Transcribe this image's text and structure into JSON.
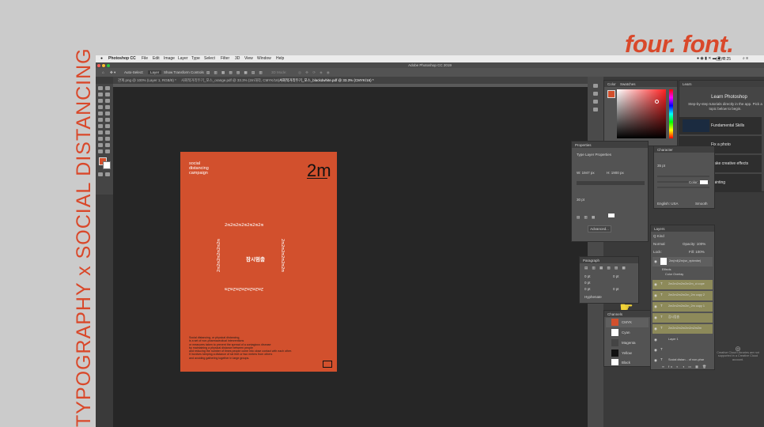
{
  "side_title": "TYPOGRAPHY x SOCIAL DISTANCING",
  "brand": {
    "text": "four. font.",
    "color": "#d9482a"
  },
  "mac_bar": {
    "app_name": "Photoshop CC",
    "menus": [
      "File",
      "Edit",
      "Image",
      "Layer",
      "Type",
      "Select",
      "Filter",
      "3D",
      "View",
      "Window",
      "Help"
    ],
    "clock": "(금) 2:25"
  },
  "ps": {
    "window_title": "Adobe Photoshop CC 2019",
    "options": {
      "auto_select": "Auto-Select:",
      "layer_select": "Layer",
      "transform": "Show Transform Controls",
      "mode_label": "3D Mode:"
    },
    "tabs": [
      "관계.png @ 100% (Layer 1, RGB/8) *",
      "사회적거리두기_포스_orange.pdf @ 33.3% (2m대각, CMYK/16) *",
      "사회적거리두기_포스_blackdwhite.pdf @ 33.3% (CMYK/16) *"
    ]
  },
  "poster": {
    "background": "#d2502d",
    "campaign_lines": [
      "social",
      "distancing",
      "campaign"
    ],
    "big_label": "2m",
    "ring_top": "2m2m2m2m2m2m2m",
    "ring_bottom": "2m2m2m2m2m2m2m",
    "ring_left": "2m2m2m2m2m2m",
    "ring_right": "2m2m2m2m2m2m",
    "center_text": "잠시멈춤",
    "body_lines": [
      "Social distancing, or physical distancing,",
      "is a set of non-pharmaceutical interventions",
      "or measures taken to prevent the spread of a contagious disease",
      "by maintaining a physical distance between people",
      "and reducing the number of times people come into close contact with each other.",
      "It involves keeping a distance of six feet or two meters from others",
      "and avoiding gathering together in large groups."
    ]
  },
  "panels": {
    "color": {
      "tab1": "Color",
      "tab2": "Swatches"
    },
    "learn": {
      "tab": "Learn",
      "title": "Learn Photoshop",
      "desc": "Step-by-step tutorials directly in the app. Pick a topic below to begin.",
      "items": [
        "Fundamental Skills",
        "Fix a photo",
        "Make creative effects",
        "Painting"
      ]
    },
    "properties": {
      "tab": "Properties",
      "type_layer": "Type Layer Properties",
      "w": "W: 1947 px",
      "h": "H: 1900 px",
      "size": "30 pt",
      "advanced": "Advanced..."
    },
    "character": {
      "tab": "Character",
      "font": "35 pt",
      "lang": "English: USA",
      "aa": "Smooth",
      "color_label": "Color:"
    },
    "paragraph": {
      "tab": "Paragraph",
      "hyphenate": "Hyphenate",
      "indent_vals": [
        "0 pt",
        "0 pt",
        "0 pt",
        "0 pt",
        "0 pt"
      ]
    },
    "layers": {
      "tab": "Layers",
      "kind": "Q Kind",
      "blend": "Normal",
      "opacity": "Opacity: 100%",
      "lock": "Lock:",
      "fill": "Fill: 100%",
      "items": [
        "2m(mil)2m(sn_eptenbe)",
        "Effects",
        "Color Overlay",
        "2m2m2m2m2m2m_ci cope",
        "2m2m2m2m2m_2m copy 2",
        "2m2m2m2m2m_2m copy 1",
        "잠시멈춤",
        "2m2m2m2m2m2m2m2m",
        "Layer 1",
        "T",
        "Social distan... of non-phar"
      ]
    },
    "channels": {
      "tab": "Channels",
      "items": [
        "CMYK",
        "Cyan",
        "Magenta",
        "Yellow",
        "Black"
      ]
    },
    "cc_note": "Creative Cloud Libraries are not supported in a Creative Cloud account."
  }
}
